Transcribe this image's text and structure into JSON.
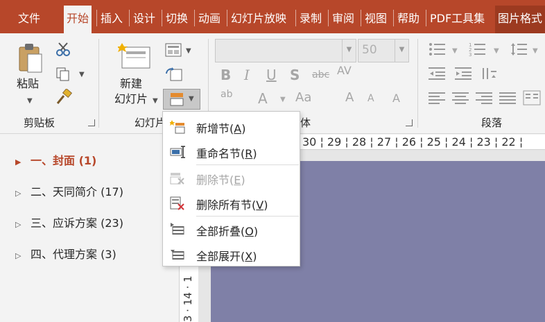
{
  "tabs": [
    {
      "label": "文件"
    },
    {
      "label": "开始"
    },
    {
      "label": "插入"
    },
    {
      "label": "设计"
    },
    {
      "label": "切换"
    },
    {
      "label": "动画"
    },
    {
      "label": "幻灯片放映"
    },
    {
      "label": "录制"
    },
    {
      "label": "审阅"
    },
    {
      "label": "视图"
    },
    {
      "label": "帮助"
    },
    {
      "label": "PDF工具集"
    },
    {
      "label": "图片格式"
    }
  ],
  "ribbon": {
    "clipboard": {
      "paste_label": "粘贴",
      "group_label": "剪贴板"
    },
    "slides": {
      "new_slide_line1": "新建",
      "new_slide_line2": "幻灯片",
      "group_label": "幻灯片"
    },
    "font": {
      "size_value": "50",
      "group_label": "字体"
    },
    "paragraph": {
      "group_label": "段落"
    }
  },
  "section_menu": {
    "items": [
      {
        "label": "新增节",
        "key": "A",
        "enabled": true
      },
      {
        "label": "重命名节",
        "key": "R",
        "enabled": true
      },
      {
        "label": "删除节",
        "key": "E",
        "enabled": false
      },
      {
        "label": "删除所有节",
        "key": "V",
        "enabled": true
      },
      {
        "label": "全部折叠",
        "key": "O",
        "enabled": true
      },
      {
        "label": "全部展开",
        "key": "X",
        "enabled": true
      }
    ]
  },
  "sections": [
    {
      "label": "一、封面 (1)",
      "active": true
    },
    {
      "label": "二、天同简介 (17)",
      "active": false
    },
    {
      "label": "三、应诉方案 (23)",
      "active": false
    },
    {
      "label": "四、代理方案 (3)",
      "active": false
    }
  ],
  "ruler": {
    "horizontal": "30 ¦ 29 ¦ 28 ¦ 27 ¦ 26 ¦ 25 ¦ 24 ¦ 23 ¦ 22 ¦",
    "vertical": "3 · 14 · 1"
  },
  "colors": {
    "accent": "#b7472a",
    "slide": "#7f80a7",
    "menu_bg": "#ffffff"
  }
}
